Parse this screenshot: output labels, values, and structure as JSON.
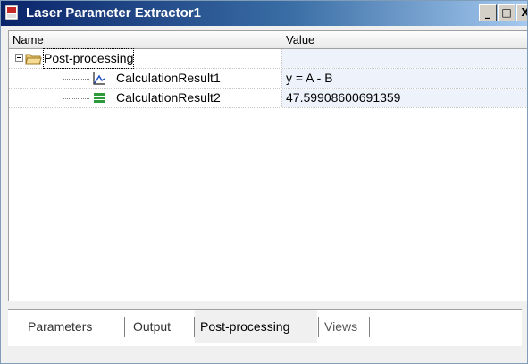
{
  "window": {
    "title": "Laser Parameter Extractor1",
    "title_bar_color": "#0a246a",
    "controls": {
      "minimize": "_",
      "maximize": "□",
      "close": "X"
    }
  },
  "grid": {
    "columns": {
      "name": "Name",
      "value": "Value"
    },
    "rows": [
      {
        "label": "Post-processing",
        "value": "",
        "icon": "folder-icon"
      },
      {
        "label": "CalculationResult1",
        "value": "y = A - B",
        "icon": "chart-icon"
      },
      {
        "label": "CalculationResult2",
        "value": "47.59908600691359",
        "icon": "data-icon"
      }
    ]
  },
  "tabs": [
    {
      "label": "Parameters",
      "active": false
    },
    {
      "label": "Output",
      "active": false
    },
    {
      "label": "Post-processing",
      "active": true
    },
    {
      "label": "Views",
      "active": false
    }
  ]
}
